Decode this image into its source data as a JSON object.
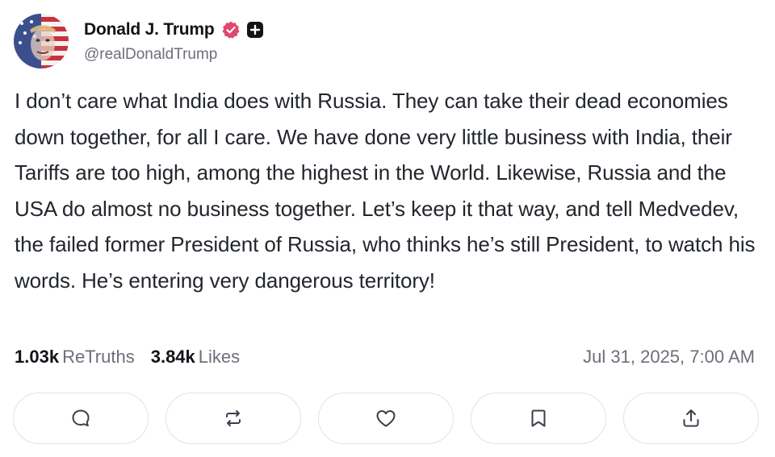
{
  "author": {
    "display_name": "Donald J. Trump",
    "handle": "@realDonaldTrump",
    "verified_icon": "verified-badge-icon",
    "badge_icon": "plus-badge-icon"
  },
  "post": {
    "text": "I don’t care what India does with Russia. They can take their dead economies down together, for all I care. We have done very little business with India, their Tariffs are too high, among the highest in the World. Likewise, Russia and the USA do almost no business together. Let’s keep it that way, and tell Medvedev, the failed former President of Russia, who thinks he’s still President, to watch his words. He’s entering very dangerous territory!",
    "retruths_count": "1.03k",
    "retruths_label": "ReTruths",
    "likes_count": "3.84k",
    "likes_label": "Likes",
    "timestamp": "Jul 31, 2025, 7:00 AM"
  },
  "actions": [
    {
      "icon": "reply-icon"
    },
    {
      "icon": "retruth-icon"
    },
    {
      "icon": "like-icon"
    },
    {
      "icon": "bookmark-icon"
    },
    {
      "icon": "share-icon"
    }
  ],
  "colors": {
    "verified": "#e0486e",
    "text": "#22262d",
    "muted": "#6b6f7a",
    "border": "#e1e3e8"
  }
}
